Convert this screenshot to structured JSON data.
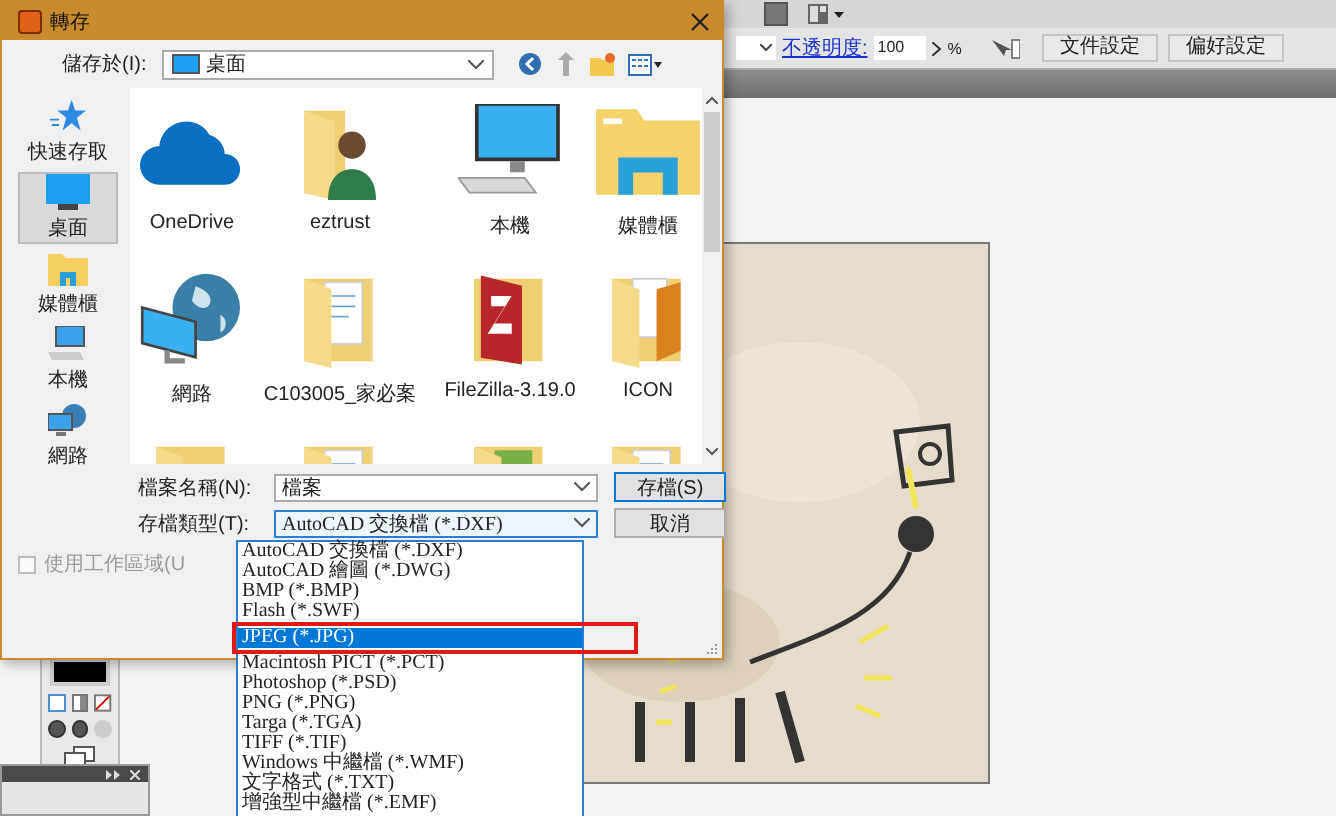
{
  "app_toolbar": {
    "opacity_label": "不透明度:",
    "opacity_value": "100",
    "percent": "%",
    "buttons": [
      "文件設定",
      "偏好設定"
    ]
  },
  "dialog": {
    "title": "轉存",
    "location_label": "儲存於(I):",
    "location": "桌面",
    "places": [
      {
        "label": "快速存取",
        "kind": "star",
        "selected": false
      },
      {
        "label": "桌面",
        "kind": "desktop",
        "selected": true
      },
      {
        "label": "媒體櫃",
        "kind": "library",
        "selected": false
      },
      {
        "label": "本機",
        "kind": "computer",
        "selected": false
      },
      {
        "label": "網路",
        "kind": "network",
        "selected": false
      }
    ],
    "items": [
      {
        "name": "OneDrive",
        "kind": "cloud"
      },
      {
        "name": "eztrust",
        "kind": "user-folder"
      },
      {
        "name": "本機",
        "kind": "computer"
      },
      {
        "name": "媒體櫃",
        "kind": "library"
      },
      {
        "name": "網路",
        "kind": "network"
      },
      {
        "name": "C103005_家必案",
        "kind": "doc-folder"
      },
      {
        "name": "FileZilla-3.19.0",
        "kind": "app-folder"
      },
      {
        "name": "ICON",
        "kind": "icon-folder"
      },
      {
        "kind": "folder"
      },
      {
        "kind": "doc-folder"
      },
      {
        "kind": "image-folder"
      },
      {
        "kind": "doc-folder"
      }
    ],
    "filename_label": "檔案名稱(N):",
    "filename": "檔案",
    "type_label": "存檔類型(T):",
    "type_value": "AutoCAD 交換檔 (*.DXF)",
    "save_button": "存檔(S)",
    "cancel_button": "取消",
    "use_workspace": {
      "label": "使用工作區域(U",
      "checked": false,
      "disabled": true
    }
  },
  "type_list": [
    {
      "label": "AutoCAD 交換檔 (*.DXF)",
      "selected": false,
      "marked": false
    },
    {
      "label": "AutoCAD 繪圖 (*.DWG)",
      "selected": false,
      "marked": false
    },
    {
      "label": "BMP (*.BMP)",
      "selected": false,
      "marked": false
    },
    {
      "label": "Flash (*.SWF)",
      "selected": false,
      "marked": false
    },
    {
      "label": "JPEG (*.JPG)",
      "selected": true,
      "marked": true
    },
    {
      "label": "Macintosh PICT (*.PCT)",
      "selected": false,
      "marked": false
    },
    {
      "label": "Photoshop (*.PSD)",
      "selected": false,
      "marked": false
    },
    {
      "label": "PNG (*.PNG)",
      "selected": false,
      "marked": false
    },
    {
      "label": "Targa (*.TGA)",
      "selected": false,
      "marked": false
    },
    {
      "label": "TIFF (*.TIF)",
      "selected": false,
      "marked": false
    },
    {
      "label": "Windows 中繼檔 (*.WMF)",
      "selected": false,
      "marked": false
    },
    {
      "label": "文字格式 (*.TXT)",
      "selected": false,
      "marked": false
    },
    {
      "label": "增強型中繼檔 (*.EMF)",
      "selected": false,
      "marked": false
    }
  ]
}
